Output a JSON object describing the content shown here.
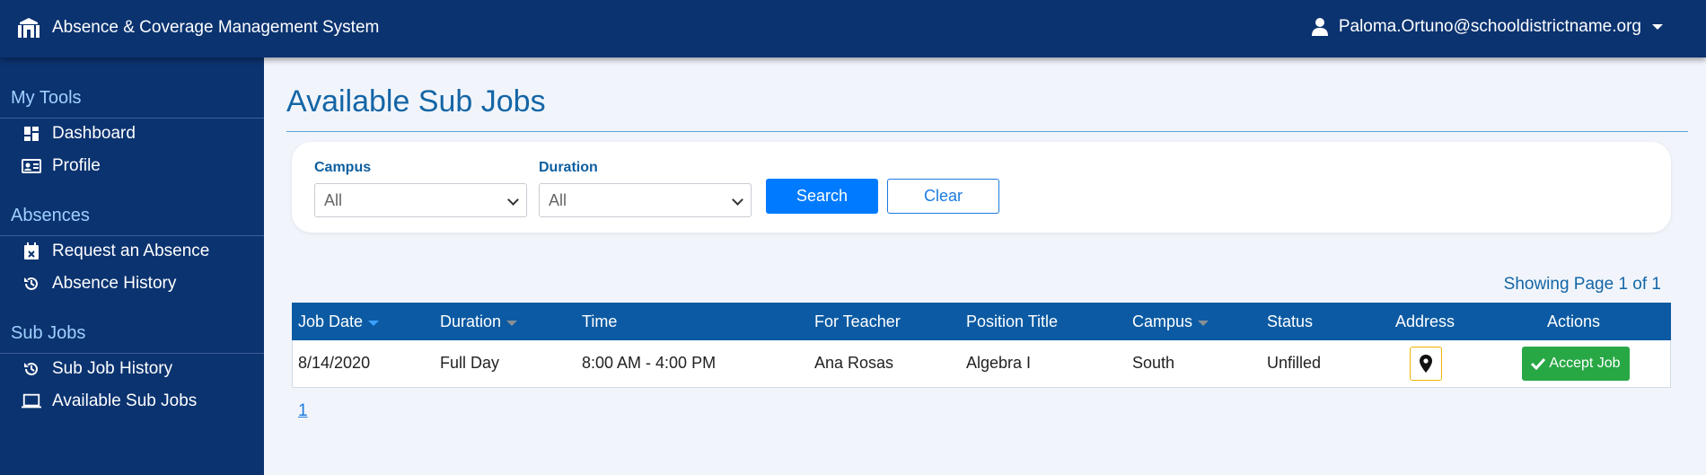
{
  "header": {
    "app_title": "Absence & Coverage Management System",
    "user_email": "Paloma.Ortuno@schooldistrictname.org",
    "logo_icon": "school-building-icon"
  },
  "sidebar": {
    "sections": [
      {
        "title": "My Tools",
        "items": [
          {
            "label": "Dashboard",
            "icon": "dashboard-icon"
          },
          {
            "label": "Profile",
            "icon": "id-card-icon"
          }
        ]
      },
      {
        "title": "Absences",
        "items": [
          {
            "label": "Request an Absence",
            "icon": "calendar-x-icon"
          },
          {
            "label": "Absence History",
            "icon": "history-icon"
          }
        ]
      },
      {
        "title": "Sub Jobs",
        "items": [
          {
            "label": "Sub Job History",
            "icon": "history-icon"
          },
          {
            "label": "Available Sub Jobs",
            "icon": "laptop-icon"
          }
        ]
      }
    ]
  },
  "main": {
    "title": "Available Sub Jobs",
    "filters": {
      "campus_label": "Campus",
      "campus_value": "All",
      "duration_label": "Duration",
      "duration_value": "All",
      "search_label": "Search",
      "clear_label": "Clear"
    },
    "showing": "Showing Page 1 of 1",
    "table": {
      "columns": [
        "Job Date",
        "Duration",
        "Time",
        "For Teacher",
        "Position Title",
        "Campus",
        "Status",
        "Address",
        "Actions"
      ],
      "rows": [
        {
          "job_date": "8/14/2020",
          "duration": "Full Day",
          "time": "8:00 AM - 4:00 PM",
          "teacher": "Ana Rosas",
          "position": "Algebra I",
          "campus": "South",
          "status": "Unfilled",
          "accept_label": "Accept Job"
        }
      ]
    },
    "pagination": {
      "current": "1"
    }
  },
  "colors": {
    "nav_bg": "#0b3370",
    "accent": "#1465a6",
    "table_header": "#0b5aa3",
    "primary_button": "#007bff",
    "success_button": "#28a745",
    "address_border": "#f0b400"
  }
}
